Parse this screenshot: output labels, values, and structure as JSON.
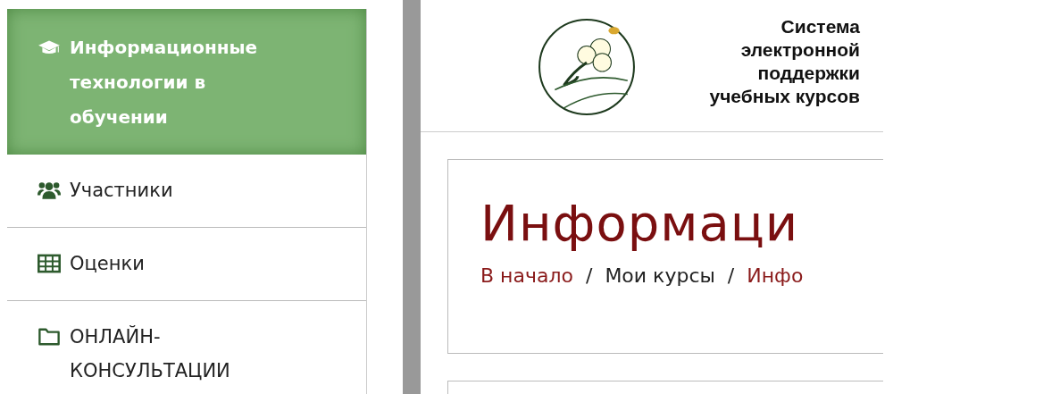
{
  "sidebar": {
    "items": [
      {
        "kind": "course",
        "label": "Информационные технологии в обучении",
        "selected": true
      },
      {
        "kind": "participants",
        "label": "Участники",
        "selected": false
      },
      {
        "kind": "grades",
        "label": "Оценки",
        "selected": false
      },
      {
        "kind": "folder",
        "label": "ОНЛАЙН-КОНСУЛЬТАЦИИ",
        "selected": false
      }
    ]
  },
  "header": {
    "site_title": "Система электронной поддержки учебных курсов"
  },
  "course": {
    "title": "Информаци",
    "breadcrumbs": [
      {
        "label": "В начало",
        "kind": "link"
      },
      {
        "label": "/",
        "kind": "separator"
      },
      {
        "label": "Мои курсы",
        "kind": "plain"
      },
      {
        "label": "/",
        "kind": "separator"
      },
      {
        "label": "Инфо",
        "kind": "link"
      }
    ]
  }
}
